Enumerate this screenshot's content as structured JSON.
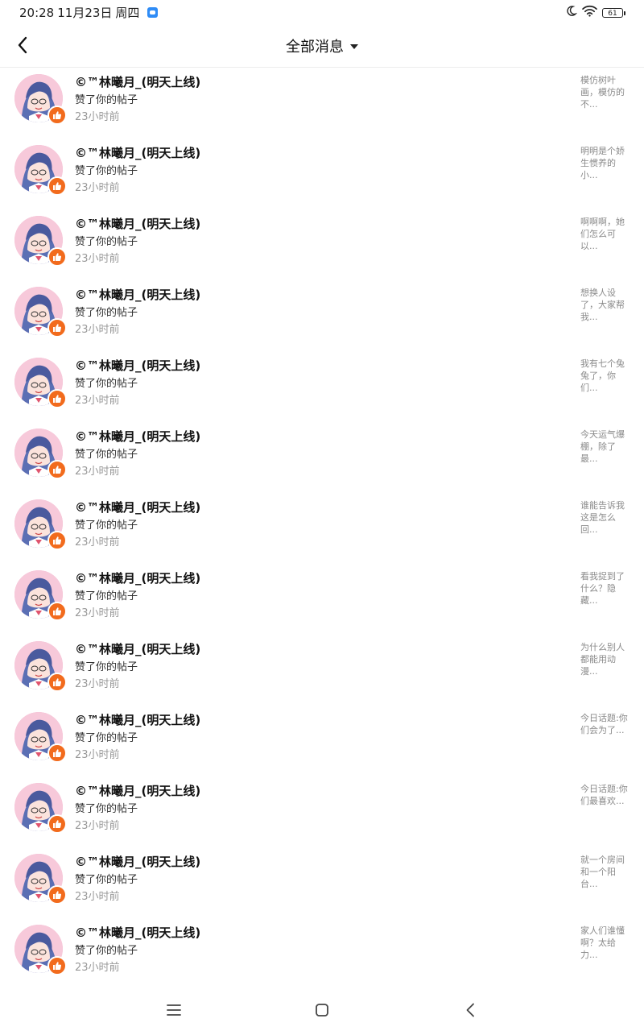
{
  "status_bar": {
    "time": "20:28",
    "date": "11月23日",
    "weekday": "周四",
    "battery": "61",
    "icons": [
      "moon-icon",
      "wifi-icon",
      "battery-icon"
    ]
  },
  "header": {
    "title": "全部消息",
    "back_icon": "chevron-left-icon",
    "dropdown_icon": "caret-down-icon"
  },
  "colors": {
    "like_badge": "#f26b1d",
    "time_text": "#999999",
    "preview_text": "#8a8a8a"
  },
  "notifications": [
    {
      "user": "©™林曦月_(明天上线)",
      "action": "赞了你的帖子",
      "time": "23小时前",
      "preview": "模仿树叶画，模仿的不..."
    },
    {
      "user": "©™林曦月_(明天上线)",
      "action": "赞了你的帖子",
      "time": "23小时前",
      "preview": "明明是个娇生惯养的小..."
    },
    {
      "user": "©™林曦月_(明天上线)",
      "action": "赞了你的帖子",
      "time": "23小时前",
      "preview": "啊啊啊，她们怎么可以..."
    },
    {
      "user": "©™林曦月_(明天上线)",
      "action": "赞了你的帖子",
      "time": "23小时前",
      "preview": "想换人设了，大家帮我..."
    },
    {
      "user": "©™林曦月_(明天上线)",
      "action": "赞了你的帖子",
      "time": "23小时前",
      "preview": "我有七个兔兔了，你们..."
    },
    {
      "user": "©™林曦月_(明天上线)",
      "action": "赞了你的帖子",
      "time": "23小时前",
      "preview": "今天运气爆棚，除了最..."
    },
    {
      "user": "©™林曦月_(明天上线)",
      "action": "赞了你的帖子",
      "time": "23小时前",
      "preview": "谁能告诉我这是怎么回..."
    },
    {
      "user": "©™林曦月_(明天上线)",
      "action": "赞了你的帖子",
      "time": "23小时前",
      "preview": "看我捉到了什么？隐藏..."
    },
    {
      "user": "©™林曦月_(明天上线)",
      "action": "赞了你的帖子",
      "time": "23小时前",
      "preview": "为什么别人都能用动漫..."
    },
    {
      "user": "©™林曦月_(明天上线)",
      "action": "赞了你的帖子",
      "time": "23小时前",
      "preview": "今日话题:你们会为了..."
    },
    {
      "user": "©™林曦月_(明天上线)",
      "action": "赞了你的帖子",
      "time": "23小时前",
      "preview": "今日话题:你们最喜欢..."
    },
    {
      "user": "©™林曦月_(明天上线)",
      "action": "赞了你的帖子",
      "time": "23小时前",
      "preview": "就一个房间和一个阳台..."
    },
    {
      "user": "©™林曦月_(明天上线)",
      "action": "赞了你的帖子",
      "time": "23小时前",
      "preview": "家人们谁懂啊？太给力..."
    }
  ],
  "nav_bar": {
    "icons": [
      "menu-icon",
      "home-icon",
      "back-icon"
    ]
  }
}
